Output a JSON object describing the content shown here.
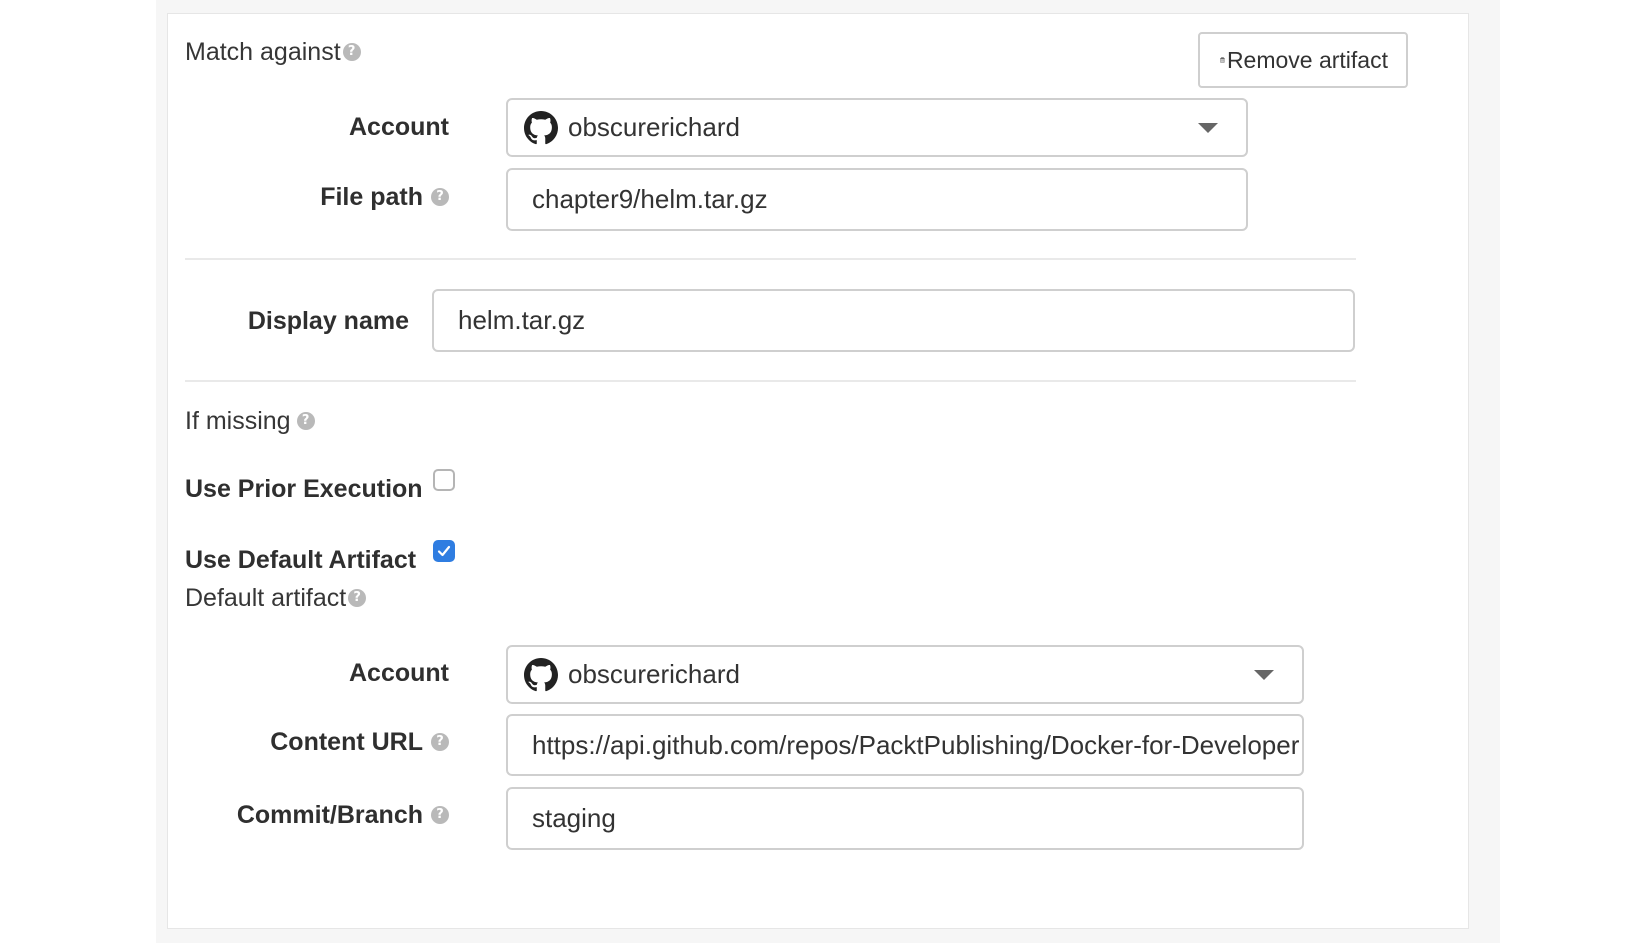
{
  "match_section": {
    "title": "Match against",
    "remove_button_label": "Remove artifact",
    "account_label": "Account",
    "account_value": "obscurerichard",
    "file_path_label": "File path",
    "file_path_value": "chapter9/helm.tar.gz"
  },
  "display_name": {
    "label": "Display name",
    "value": "helm.tar.gz"
  },
  "missing_section": {
    "title": "If missing",
    "use_prior_label": "Use Prior Execution",
    "use_prior_checked": false,
    "use_default_label": "Use Default Artifact",
    "use_default_checked": true
  },
  "default_artifact": {
    "title": "Default artifact",
    "account_label": "Account",
    "account_value": "obscurerichard",
    "content_url_label": "Content URL",
    "content_url_value": "https://api.github.com/repos/PacktPublishing/Docker-for-Developer",
    "commit_label": "Commit/Branch",
    "commit_value": "staging"
  },
  "icons": {
    "help": "help-icon",
    "trash": "trash-icon",
    "github": "github-icon",
    "caret": "caret-down-icon",
    "check": "checkmark-icon"
  },
  "colors": {
    "checkbox_checked": "#2f7de1",
    "border": "#cfcfcf"
  }
}
